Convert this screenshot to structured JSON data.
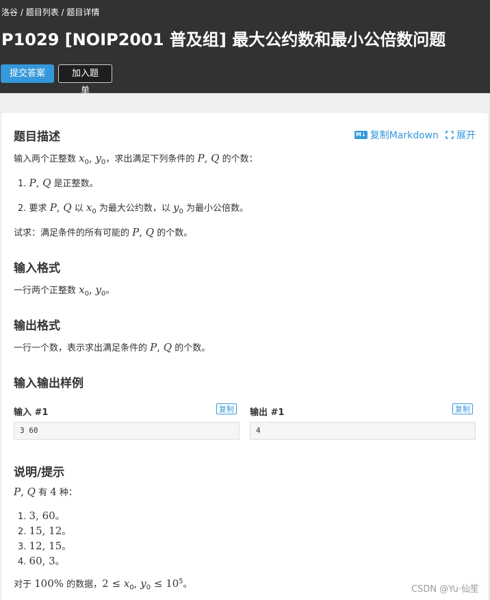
{
  "breadcrumb": {
    "home": "洛谷",
    "sep": " / ",
    "list": "题目列表",
    "detail": "题目详情"
  },
  "title": "P1029 [NOIP2001 普及组] 最大公约数和最小公倍数问题",
  "actions": {
    "submit": "提交答案",
    "add_to_list": "加入题单"
  },
  "toolbar": {
    "copy_md": "复制Markdown",
    "copy_md_icon": "markdown-icon",
    "md_badge": "M↓",
    "expand": "展开",
    "expand_icon": "expand-icon"
  },
  "sections": {
    "description": "题目描述",
    "input_format": "输入格式",
    "output_format": "输出格式",
    "samples": "输入输出样例",
    "hint": "说明/提示"
  },
  "description": {
    "intro_a": "输入两个正整数 ",
    "intro_b": "，求出满足下列条件的 ",
    "intro_c": " 的个数：",
    "item1_num": "1.",
    "item1_text": " 是正整数。",
    "item2_num": "2.",
    "item2_a": "要求 ",
    "item2_b": " 以 ",
    "item2_c": " 为最大公约数，以 ",
    "item2_d": " 为最小公倍数。",
    "ask_a": "试求：满足条件的所有可能的 ",
    "ask_b": " 的个数。"
  },
  "input_format": {
    "text_a": "一行两个正整数 ",
    "text_b": "。"
  },
  "output_format": {
    "text_a": "一行一个数，表示求出满足条件的 ",
    "text_b": " 的个数。"
  },
  "samples": {
    "input_label": "输入 #1",
    "output_label": "输出 #1",
    "copy": "复制",
    "input_value": "3 60",
    "output_value": "4"
  },
  "hint": {
    "count_a": " 有 ",
    "count_num": "4",
    "count_b": " 种：",
    "items": [
      {
        "num": "1.",
        "pair": "3, 60",
        "end": "。"
      },
      {
        "num": "2.",
        "pair": "15, 12",
        "end": "。"
      },
      {
        "num": "3.",
        "pair": "12, 15",
        "end": "。"
      },
      {
        "num": "4.",
        "pair": "60, 3",
        "end": "。"
      }
    ],
    "range_a": "对于 ",
    "range_pct": "100%",
    "range_b": " 的数据，",
    "range_c": "。"
  },
  "math": {
    "P": "P",
    "Q": "Q",
    "x": "x",
    "y": "y",
    "sub0": "0",
    "comma": ", ",
    "two": "2",
    "le": " ≤ ",
    "ten": "10",
    "five": "5"
  },
  "watermark": "CSDN @Yu·仙笙",
  "colors": {
    "header_bg": "#303234",
    "accent": "#3498db",
    "page_bg": "#efefef"
  }
}
